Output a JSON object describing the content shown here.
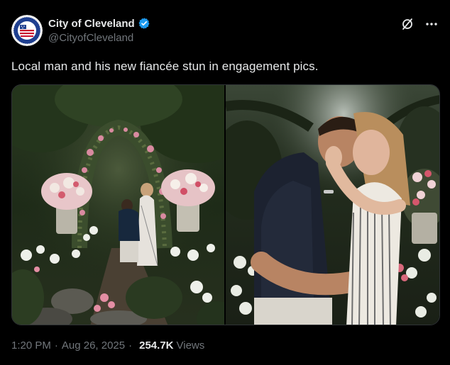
{
  "author": {
    "display_name": "City of Cleveland",
    "handle": "@CityofCleveland",
    "avatar_icon": "city-seal-avatar",
    "verified_icon": "verified-badge-icon"
  },
  "actions": {
    "grok_icon": "grok-icon",
    "more_icon": "more-icon"
  },
  "post": {
    "text": "Local man and his new fiancée stun in engagement pics."
  },
  "media": {
    "photos": [
      {
        "icon": "garden-engagement-photo"
      },
      {
        "icon": "couple-embrace-photo"
      }
    ]
  },
  "meta": {
    "time": "1:20 PM",
    "date": "Aug 26, 2025",
    "separator": "·",
    "views_count": "254.7K",
    "views_label": "Views"
  },
  "colors": {
    "background": "#000000",
    "text": "#e7e9ea",
    "secondary": "#71767b",
    "verified": "#1d9bf0"
  }
}
